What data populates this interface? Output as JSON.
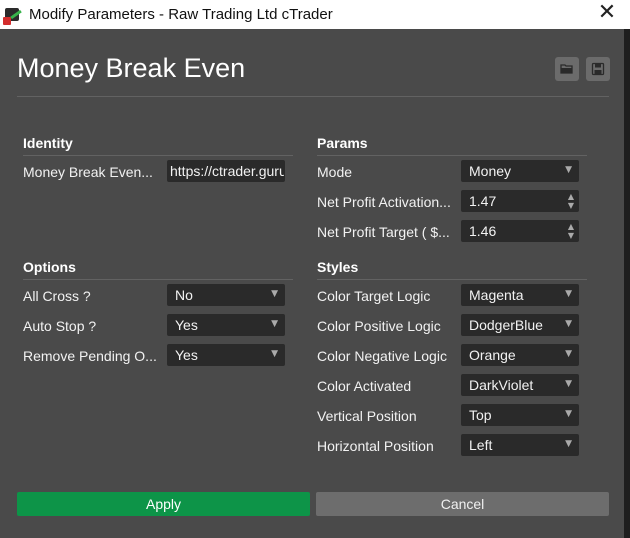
{
  "window": {
    "title": "Modify Parameters - Raw Trading Ltd cTrader",
    "close_glyph": "✕"
  },
  "page": {
    "title": "Money Break Even"
  },
  "identity": {
    "title": "Identity",
    "rows": [
      {
        "label": "Money Break Even...",
        "value": "https://ctrader.guru",
        "type": "text"
      }
    ]
  },
  "params": {
    "title": "Params",
    "rows": [
      {
        "label": "Mode",
        "value": "Money",
        "type": "select"
      },
      {
        "label": "Net Profit Activation...",
        "value": "1.47",
        "type": "number"
      },
      {
        "label": "Net Profit Target ( $...",
        "value": "1.46",
        "type": "number"
      }
    ]
  },
  "options": {
    "title": "Options",
    "rows": [
      {
        "label": "All Cross ?",
        "value": "No",
        "type": "select"
      },
      {
        "label": "Auto Stop ?",
        "value": "Yes",
        "type": "select"
      },
      {
        "label": "Remove Pending O...",
        "value": "Yes",
        "type": "select"
      }
    ]
  },
  "styles": {
    "title": "Styles",
    "rows": [
      {
        "label": "Color Target Logic",
        "value": "Magenta",
        "type": "select"
      },
      {
        "label": "Color Positive Logic",
        "value": "DodgerBlue",
        "type": "select"
      },
      {
        "label": "Color Negative Logic",
        "value": "Orange",
        "type": "select"
      },
      {
        "label": "Color Activated",
        "value": "DarkViolet",
        "type": "select"
      },
      {
        "label": "Vertical Position",
        "value": "Top",
        "type": "select"
      },
      {
        "label": "Horizontal Position",
        "value": "Left",
        "type": "select"
      }
    ]
  },
  "buttons": {
    "apply": "Apply",
    "cancel": "Cancel"
  },
  "icons": {
    "caret": "▼",
    "spin_up": "▲",
    "spin_down": "▼"
  },
  "colors": {
    "apply": "#0d9448",
    "cancel": "#6d6d6d",
    "panel": "#4a4a4a",
    "field": "#2a2a2a"
  }
}
